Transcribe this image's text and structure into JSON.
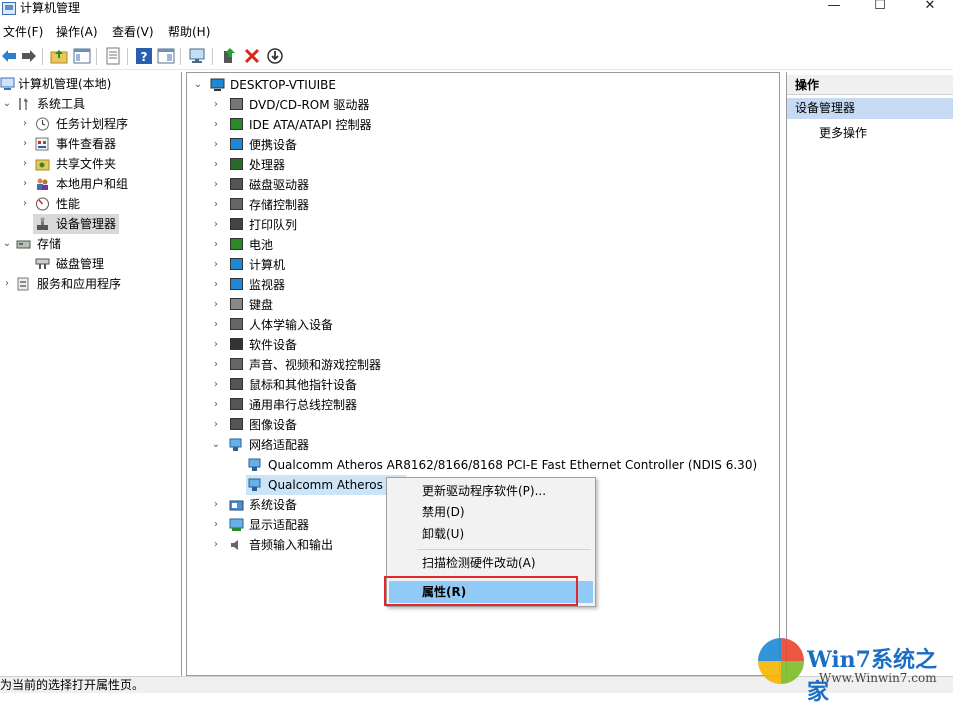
{
  "window": {
    "title": "计算机管理",
    "minimize": "—",
    "maximize": "☐",
    "close": "✕"
  },
  "menu": [
    "文件(F)",
    "操作(A)",
    "查看(V)",
    "帮助(H)"
  ],
  "left_tree": {
    "root": "计算机管理(本地)",
    "system_tools": "系统工具",
    "items": [
      "任务计划程序",
      "事件查看器",
      "共享文件夹",
      "本地用户和组",
      "性能",
      "设备管理器"
    ],
    "storage": "存储",
    "disk": "磁盘管理",
    "services": "服务和应用程序"
  },
  "device_tree": {
    "root": "DESKTOP-VTIUIBE",
    "categories": [
      "DVD/CD-ROM 驱动器",
      "IDE ATA/ATAPI 控制器",
      "便携设备",
      "处理器",
      "磁盘驱动器",
      "存储控制器",
      "打印队列",
      "电池",
      "计算机",
      "监视器",
      "键盘",
      "人体学输入设备",
      "软件设备",
      "声音、视频和游戏控制器",
      "鼠标和其他指针设备",
      "通用串行总线控制器",
      "图像设备"
    ],
    "network": "网络适配器",
    "network_children": [
      "Qualcomm Atheros AR8162/8166/8168 PCI-E Fast Ethernet Controller (NDIS 6.30)",
      "Qualcomm Atheros A"
    ],
    "after": [
      "系统设备",
      "显示适配器",
      "音频输入和输出"
    ]
  },
  "actions": {
    "header": "操作",
    "section": "设备管理器",
    "more": "更多操作"
  },
  "context_menu": {
    "items": [
      "更新驱动程序软件(P)...",
      "禁用(D)",
      "卸载(U)",
      "扫描检测硬件改动(A)",
      "属性(R)"
    ],
    "active": "属性(R)"
  },
  "status": "为当前的选择打开属性页。",
  "watermark": {
    "title": "Win7系统之家",
    "url": "Www.Winwin7.com"
  },
  "colors": {
    "selection": "#91c9f7",
    "highlight_box": "#e0282d",
    "action_section": "#c6dbf3"
  }
}
